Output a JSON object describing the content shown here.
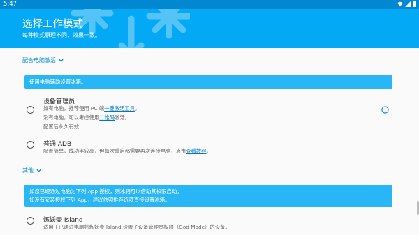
{
  "status_bar": {
    "time": "5:47",
    "icons": [
      "wifi-icon",
      "signal-icon",
      "battery-icon"
    ]
  },
  "header": {
    "title": "选择工作模式",
    "subtitle": "每种模式原理不同，效果一致。",
    "background": "#03a9f4",
    "decoration": "snowflake-icon"
  },
  "sections": {
    "pc": {
      "label": "配合电脑激活",
      "banner": "使用电脑辅助设置冰箱。",
      "device_admin": {
        "title": "设备管理员",
        "line1_pre": "如有电脑，推荐使用 PC 端",
        "line1_link": "一键激活工具",
        "line1_post": "。",
        "line2_pre": "没有电脑，可以考虑使用",
        "line2_link": "二维码",
        "line2_post": "激活。",
        "line3": "配置后永久有效"
      },
      "adb": {
        "title": "普通 ADB",
        "line1_pre": "配置简单，成功率较高，但每次重启都需要再次连接电脑，点击",
        "line1_link": "查看教程",
        "line1_post": "。"
      }
    },
    "other": {
      "label": "其他",
      "banner_line1": "如您已经通过电脑为下列 App 授权，则冰箱可以借助其权限启动。",
      "banner_line2": "如没有安装授权下列 App，建议依照推荐选项直接设置冰箱。",
      "island": {
        "title": "炼妖壶 Island",
        "line1": "适用于已通过电脑将炼妖壶 Island 设置了设备管理员权限（God Mode）的设备。"
      }
    }
  },
  "colors": {
    "accent": "#0288d1",
    "banner": "#29b6f6",
    "link": "#0277bd"
  }
}
